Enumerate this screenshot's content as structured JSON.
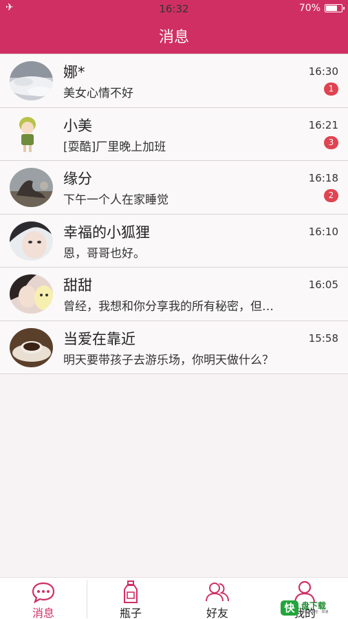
{
  "status_bar": {
    "time": "16:32",
    "battery": "70%"
  },
  "header": {
    "title": "消息"
  },
  "conversations": [
    {
      "name": "娜*",
      "preview": "美女心情不好",
      "time": "16:30",
      "unread": "1"
    },
    {
      "name": "小美",
      "preview": "[耍酷]厂里晚上加班",
      "time": "16:21",
      "unread": "3"
    },
    {
      "name": "缘分",
      "preview": "下午一个人在家睡觉",
      "time": "16:18",
      "unread": "2"
    },
    {
      "name": "幸福的小狐狸",
      "preview": "恩，哥哥也好。",
      "time": "16:10",
      "unread": ""
    },
    {
      "name": "甜甜",
      "preview": "曾经，我想和你分享我的所有秘密，但…",
      "time": "16:05",
      "unread": ""
    },
    {
      "name": "当爱在靠近",
      "preview": "明天要带孩子去游乐场，你明天做什么？",
      "time": "15:58",
      "unread": ""
    }
  ],
  "tabbar": {
    "tabs": [
      {
        "label": "消息",
        "icon": "chat-bubble-icon",
        "active": true
      },
      {
        "label": "瓶子",
        "icon": "bottle-icon",
        "active": false
      },
      {
        "label": "好友",
        "icon": "friends-icon",
        "active": false
      },
      {
        "label": "我的",
        "icon": "user-icon",
        "active": false
      }
    ]
  },
  "watermark": {
    "mark": "快",
    "brand": "盘下载",
    "tag": "绿色 · 安全 · 高速"
  },
  "colors": {
    "primary": "#d02f63",
    "badge": "#e04351",
    "background": "#f7f3f5"
  }
}
